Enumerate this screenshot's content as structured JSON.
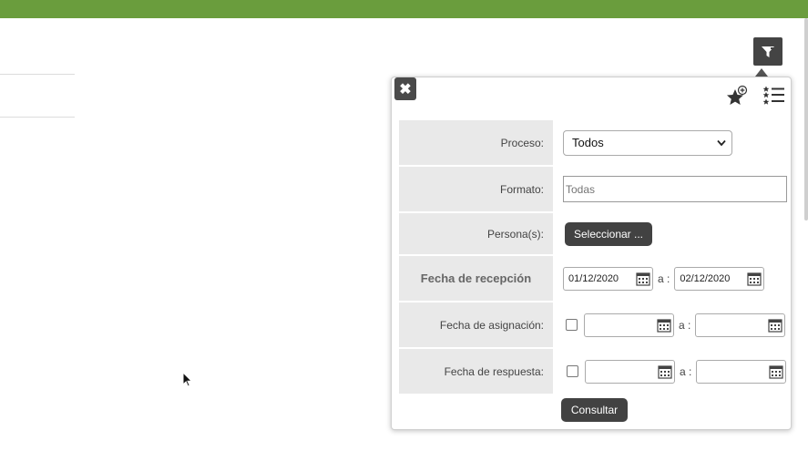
{
  "filter_panel": {
    "close_label": "✖",
    "proceso": {
      "label": "Proceso:",
      "value": "Todos"
    },
    "formato": {
      "label": "Formato:",
      "placeholder": "Todas"
    },
    "personas": {
      "label": "Persona(s):",
      "button": "Seleccionar ..."
    },
    "fecha_recepcion": {
      "label": "Fecha de recepción",
      "from": "01/12/2020",
      "separator": "a :",
      "to": "02/12/2020"
    },
    "fecha_asignacion": {
      "label": "Fecha de asignación:",
      "separator": "a :"
    },
    "fecha_respuesta": {
      "label": "Fecha de respuesta:",
      "separator": "a :"
    },
    "consultar_button": "Consultar"
  },
  "colors": {
    "top_bar": "#6a9d3d",
    "dark_button": "#424242",
    "label_bg": "#e9e9e9"
  },
  "icons": [
    "filter-icon",
    "close-icon",
    "star-plus-icon",
    "starred-list-icon",
    "calendar-icon",
    "chevron-down-icon",
    "mouse-cursor-icon"
  ]
}
